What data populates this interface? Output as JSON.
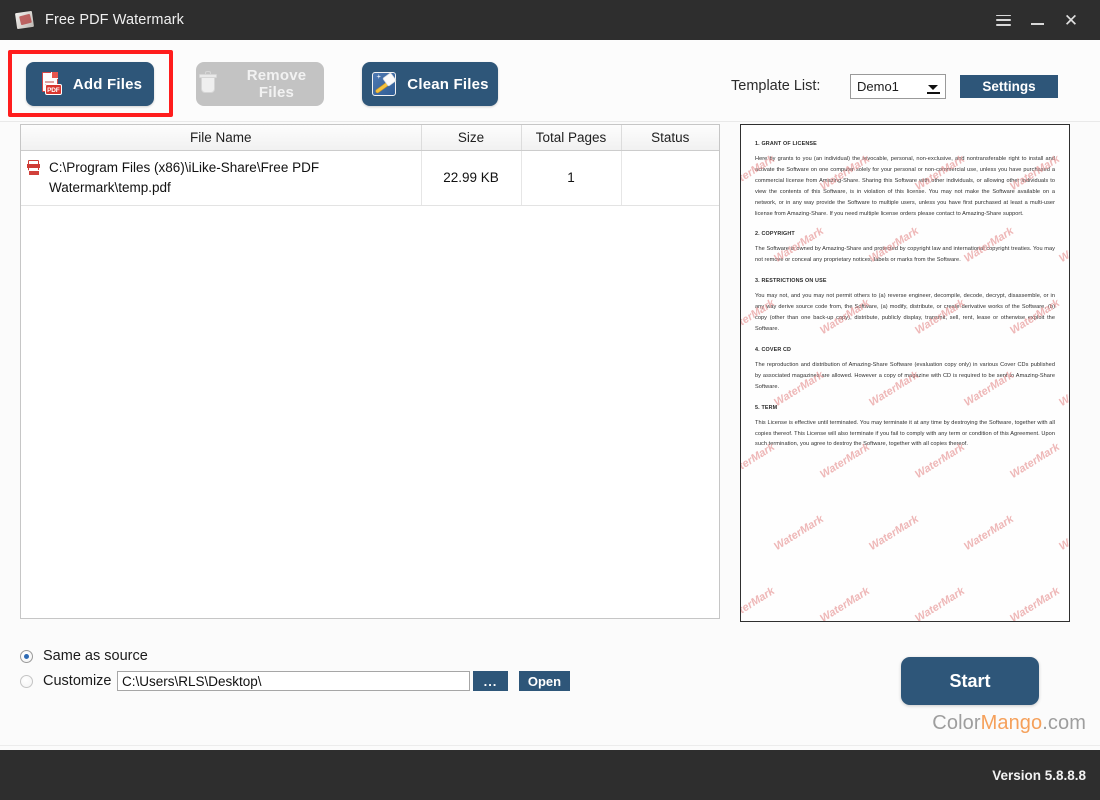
{
  "window": {
    "title": "Free PDF Watermark",
    "app_icon": "pdf-watermark-app-icon",
    "controls": {
      "menu": "hamburger-menu-icon",
      "minimize": "minimize-icon",
      "close": "close-icon"
    }
  },
  "toolbar": {
    "add_files": "Add Files",
    "remove_files": "Remove Files",
    "clean_files": "Clean Files",
    "add_files_icon": "add-pdf-icon",
    "remove_files_icon": "trash-icon",
    "clean_files_icon": "broom-icon",
    "highlight_color": "#ff1d1d",
    "accent_color": "#2e5679",
    "disabled_color": "#c3c3c3"
  },
  "template": {
    "label": "Template List:",
    "selected": "Demo1",
    "options": [
      "Demo1"
    ],
    "settings_button": "Settings"
  },
  "file_table": {
    "columns": [
      "File Name",
      "Size",
      "Total Pages",
      "Status"
    ],
    "rows": [
      {
        "icon": "pdf-file-icon",
        "file_name": "C:\\Program Files (x86)\\iLike-Share\\Free PDF Watermark\\temp.pdf",
        "size": "22.99 KB",
        "total_pages": "1",
        "status": ""
      }
    ]
  },
  "preview": {
    "watermark_text": "WaterMark",
    "watermark_color": "#e58c8c",
    "sections": [
      {
        "heading": "1. GRANT OF LICENSE",
        "body": "Here by grants to you (an individual) the revocable, personal, non-exclusive, and nontransferable right to install and activate the Software on one computer solely for your personal or non-commercial use, unless you have purchased a commercial license from Amazing-Share. Sharing this Software with other individuals, or allowing other individuals to view the contents of this Software, is in violation of this license. You may not make the Software available on a network, or in any way provide the Software to multiple users, unless you have first purchased at least a multi-user license from Amazing-Share. If you need multiple license orders please contact to Amazing-Share support."
      },
      {
        "heading": "2. COPYRIGHT",
        "body": "The Software is owned by Amazing-Share and protected by copyright law and international copyright treaties. You may not remove or conceal any proprietary notices, labels or marks from the Software."
      },
      {
        "heading": "3. RESTRICTIONS ON USE",
        "body": "You may not, and you may not permit others to (a) reverse engineer, decompile, decode, decrypt, disassemble, or in any way derive source code from, the Software, (a) modify, distribute, or create derivative works of the Software, (b) copy (other than one back-up copy), distribute, publicly display, transmit, sell, rent, lease or otherwise exploit the Software."
      },
      {
        "heading": "4. COVER CD",
        "body": "The reproduction and distribution of Amazing-Share Software (evaluation copy only) in various Cover CDs published by associated magazines are allowed. However a copy of magazine with CD is required to be sent to Amazing-Share Software."
      },
      {
        "heading": "5. TERM",
        "body": "This License is effective until terminated. You may terminate it at any time by destroying the Software, together with all copies thereof. This License will also terminate if you fail to comply with any term or condition of this Agreement. Upon such termination, you agree to destroy the Software, together with all copies thereof."
      }
    ]
  },
  "output": {
    "same_as_source_label": "Same as source",
    "customize_label": "Customize",
    "selected_mode": "same_as_source",
    "path_value": "C:\\Users\\RLS\\Desktop\\",
    "browse_button": "...",
    "open_button": "Open"
  },
  "actions": {
    "start_button": "Start"
  },
  "brand": {
    "part1": "Color",
    "part2": "Mango",
    "part3": ".com",
    "part2_color": "#f5a05a"
  },
  "footer": {
    "version": "Version 5.8.8.8"
  }
}
